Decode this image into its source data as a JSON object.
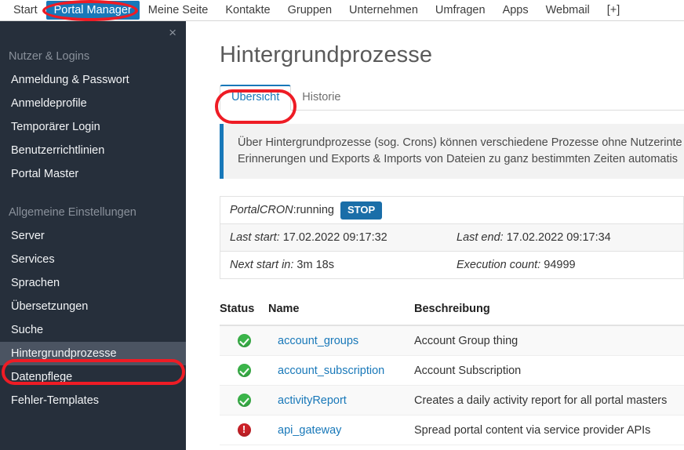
{
  "topnav": {
    "items": [
      {
        "label": "Start",
        "active": false
      },
      {
        "label": "Portal Manager",
        "active": true
      },
      {
        "label": "Meine Seite",
        "active": false
      },
      {
        "label": "Kontakte",
        "active": false
      },
      {
        "label": "Gruppen",
        "active": false
      },
      {
        "label": "Unternehmen",
        "active": false
      },
      {
        "label": "Umfragen",
        "active": false
      },
      {
        "label": "Apps",
        "active": false
      },
      {
        "label": "Webmail",
        "active": false
      },
      {
        "label": "[+]",
        "active": false
      }
    ]
  },
  "sidebar": {
    "close_icon": "×",
    "sections": [
      {
        "title": "Nutzer & Logins",
        "items": [
          {
            "label": "Anmeldung & Passwort",
            "active": false
          },
          {
            "label": "Anmeldeprofile",
            "active": false
          },
          {
            "label": "Temporärer Login",
            "active": false
          },
          {
            "label": "Benutzerrichtlinien",
            "active": false
          },
          {
            "label": "Portal Master",
            "active": false
          }
        ]
      },
      {
        "title": "Allgemeine Einstellungen",
        "items": [
          {
            "label": "Server",
            "active": false
          },
          {
            "label": "Services",
            "active": false
          },
          {
            "label": "Sprachen",
            "active": false
          },
          {
            "label": "Übersetzungen",
            "active": false
          },
          {
            "label": "Suche",
            "active": false
          },
          {
            "label": "Hintergrundprozesse",
            "active": true
          },
          {
            "label": "Datenpflege",
            "active": false
          },
          {
            "label": "Fehler-Templates",
            "active": false
          }
        ]
      }
    ]
  },
  "main": {
    "title": "Hintergrundprozesse",
    "tabs": [
      {
        "label": "Übersicht",
        "active": true
      },
      {
        "label": "Historie",
        "active": false
      }
    ],
    "alert": {
      "line1": "Über Hintergrundprozesse (sog. Crons) können verschiedene Prozesse ohne Nutzerinte",
      "line2": "Erinnerungen und Exports & Imports von Dateien zu ganz bestimmten Zeiten automatis"
    },
    "cron": {
      "name_label": "PortalCRON",
      "state": ":running",
      "stop_label": "STOP",
      "last_start_label": "Last start:",
      "last_start_value": "17.02.2022 09:17:32",
      "last_end_label": "Last end:",
      "last_end_value": "17.02.2022 09:17:34",
      "next_start_label": "Next start in:",
      "next_start_value": "3m 18s",
      "execution_count_label": "Execution count:",
      "execution_count_value": "94999"
    },
    "table": {
      "columns": [
        "Status",
        "Name",
        "Beschreibung"
      ],
      "rows": [
        {
          "status": "ok",
          "status_icon": "check-circle-icon",
          "name": "account_groups",
          "description": "Account Group thing"
        },
        {
          "status": "ok",
          "status_icon": "check-circle-icon",
          "name": "account_subscription",
          "description": "Account Subscription"
        },
        {
          "status": "ok",
          "status_icon": "check-circle-icon",
          "name": "activityReport",
          "description": "Creates a daily activity report for all portal masters"
        },
        {
          "status": "err",
          "status_icon": "error-circle-icon",
          "name": "api_gateway",
          "description": "Spread portal content via service provider APIs"
        }
      ]
    }
  },
  "colors": {
    "accent_blue": "#1878b9",
    "sidebar_bg": "#262f3b",
    "sidebar_active": "#4b5462",
    "annotation_red": "#ee1c25",
    "status_ok_green": "#3bb54a",
    "status_error_red": "#cc2229",
    "stop_button_blue": "#1a6ea8"
  }
}
